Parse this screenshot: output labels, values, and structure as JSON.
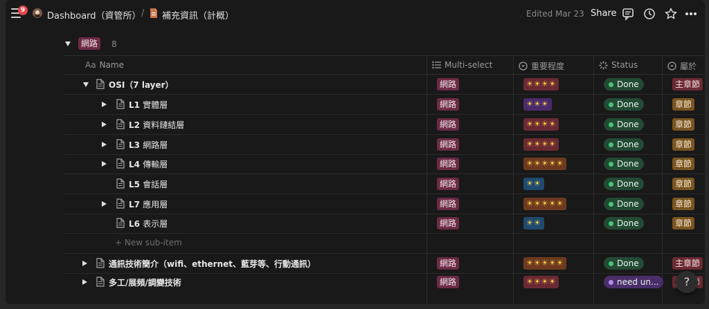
{
  "topbar": {
    "notification_count": "9",
    "crumbs": [
      "Dashboard（資管所）",
      "補充資訊（計概）"
    ],
    "separator": "/",
    "edited": "Edited Mar 23",
    "share_label": "Share",
    "icons": [
      "comment-icon",
      "clock-icon",
      "star-icon",
      "more-icon"
    ]
  },
  "group": {
    "tag": "網路",
    "count": "8"
  },
  "columns": {
    "name": "Name",
    "name_prefix": "Aa",
    "multiselect": "Multi-select",
    "importance": "重要程度",
    "status": "Status",
    "belongs": "屬於"
  },
  "rows": [
    {
      "title": "OSI（7 layer）",
      "multi": "網路",
      "importance": "☀☀☀☀",
      "status": "Done",
      "belongs": "主章節"
    },
    {
      "title": "L1",
      "subtitle": "實體層",
      "multi": "網路",
      "importance": "☀☀☀",
      "status": "Done",
      "belongs": "章節"
    },
    {
      "title": "L2",
      "subtitle": "資料鏈結層",
      "multi": "網路",
      "importance": "☀☀☀☀",
      "status": "Done",
      "belongs": "章節"
    },
    {
      "title": "L3",
      "subtitle": "網路層",
      "multi": "網路",
      "importance": "☀☀☀☀",
      "status": "Done",
      "belongs": "章節"
    },
    {
      "title": "L4",
      "subtitle": "傳輸層",
      "multi": "網路",
      "importance": "☀☀☀☀☀",
      "status": "Done",
      "belongs": "章節"
    },
    {
      "title": "L5",
      "subtitle": "會話層",
      "multi": "網路",
      "importance": "☀☀",
      "status": "Done",
      "belongs": "章節"
    },
    {
      "title": "L7",
      "subtitle": "應用層",
      "multi": "網路",
      "importance": "☀☀☀☀☀",
      "status": "Done",
      "belongs": "章節"
    },
    {
      "title": "L6",
      "subtitle": "表示層",
      "multi": "網路",
      "importance": "☀☀",
      "status": "Done",
      "belongs": "章節"
    },
    {
      "title": "通訊技術簡介（wifi、ethernet、藍芽等、行動通訊）",
      "multi": "網路",
      "importance": "☀☀☀☀☀",
      "status": "Done",
      "belongs": "主章節"
    },
    {
      "title": "多工/展頻/調變技術",
      "multi": "網路",
      "importance": "☀☀☀☀",
      "status": "need un...",
      "belongs": "主章節"
    }
  ],
  "new_sub_item": "New sub-item",
  "help": "?",
  "colors": {
    "tag_net": "#6b2a45",
    "done": "#234a34",
    "need": "#4a2e6b",
    "main_chapter": "#6b2a33",
    "chapter": "#7a5420"
  }
}
